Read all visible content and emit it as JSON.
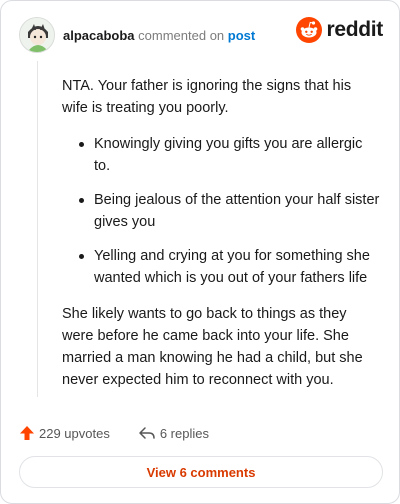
{
  "header": {
    "username": "alpacaboba",
    "action_text": "commented on",
    "post_link": "post",
    "brand": "reddit"
  },
  "comment": {
    "intro": "NTA. Your father is ignoring the signs that his wife is treating you poorly.",
    "bullets": [
      "Knowingly giving you gifts you are allergic to.",
      "Being jealous of the attention your half sister gives you",
      "Yelling and crying at you for something she wanted which is you out of your fathers life"
    ],
    "closing": "She likely wants to go back to things as they were before he came back into your life. She married a man knowing he had a child, but she never expected him to reconnect with you."
  },
  "footer": {
    "upvotes": "229 upvotes",
    "replies": "6 replies"
  },
  "view_comments_label": "View 6 comments",
  "colors": {
    "upvote": "#ff4500",
    "link": "#0079d3",
    "view_button_text": "#d93a00",
    "reddit_orange": "#ff4500"
  },
  "icons": {
    "avatar": "avatar-icon",
    "brand": "reddit-logo-icon",
    "upvote": "upvote-arrow-icon",
    "reply": "reply-arrow-icon"
  }
}
